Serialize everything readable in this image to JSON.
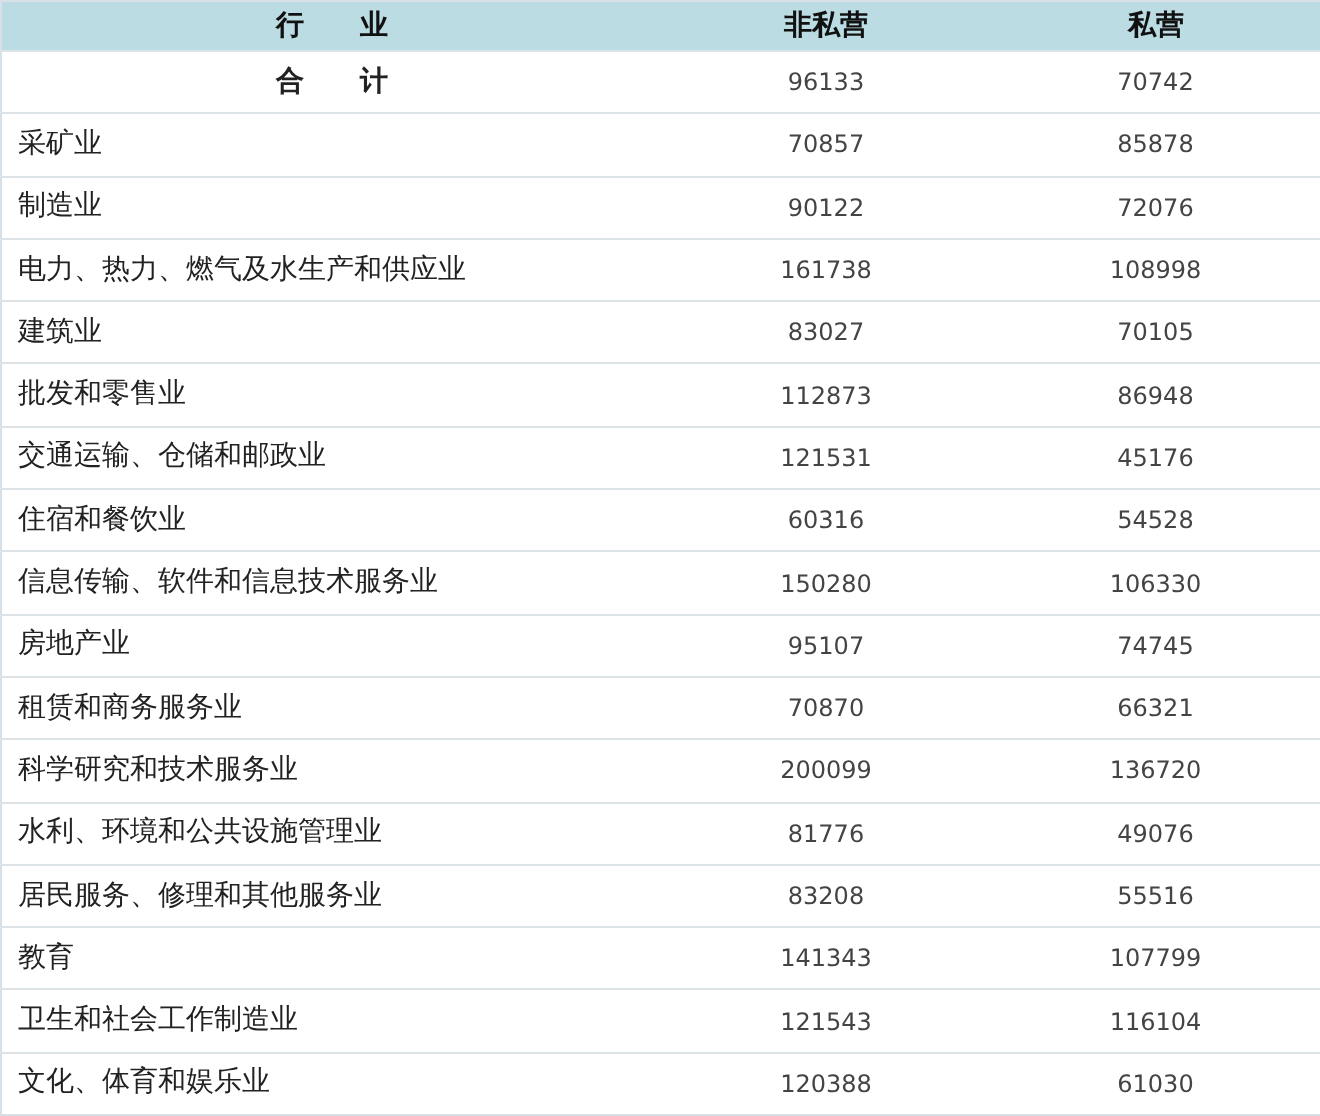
{
  "table": {
    "columns": [
      "行　　业",
      "非私营",
      "私营"
    ],
    "rows": [
      {
        "kind": "total",
        "cells": [
          "合　　计",
          "96133",
          "70742"
        ]
      },
      {
        "kind": "item",
        "cells": [
          "采矿业",
          "70857",
          "85878"
        ]
      },
      {
        "kind": "item",
        "cells": [
          "制造业",
          "90122",
          "72076"
        ]
      },
      {
        "kind": "item",
        "cells": [
          "电力、热力、燃气及水生产和供应业",
          "161738",
          "108998"
        ]
      },
      {
        "kind": "item",
        "cells": [
          "建筑业",
          "83027",
          "70105"
        ]
      },
      {
        "kind": "item",
        "cells": [
          "批发和零售业",
          "112873",
          "86948"
        ]
      },
      {
        "kind": "item",
        "cells": [
          "交通运输、仓储和邮政业",
          "121531",
          "45176"
        ]
      },
      {
        "kind": "item",
        "cells": [
          "住宿和餐饮业",
          "60316",
          "54528"
        ]
      },
      {
        "kind": "item",
        "cells": [
          "信息传输、软件和信息技术服务业",
          "150280",
          "106330"
        ]
      },
      {
        "kind": "item",
        "cells": [
          "房地产业",
          "95107",
          "74745"
        ]
      },
      {
        "kind": "item",
        "cells": [
          "租赁和商务服务业",
          "70870",
          "66321"
        ]
      },
      {
        "kind": "item",
        "cells": [
          "科学研究和技术服务业",
          "200099",
          "136720"
        ]
      },
      {
        "kind": "item",
        "cells": [
          "水利、环境和公共设施管理业",
          "81776",
          "49076"
        ]
      },
      {
        "kind": "item",
        "cells": [
          "居民服务、修理和其他服务业",
          "83208",
          "55516"
        ]
      },
      {
        "kind": "item",
        "cells": [
          "教育",
          "141343",
          "107799"
        ]
      },
      {
        "kind": "item",
        "cells": [
          "卫生和社会工作制造业",
          "121543",
          "116104"
        ]
      },
      {
        "kind": "item",
        "cells": [
          "文化、体育和娱乐业",
          "120388",
          "61030"
        ]
      }
    ]
  }
}
